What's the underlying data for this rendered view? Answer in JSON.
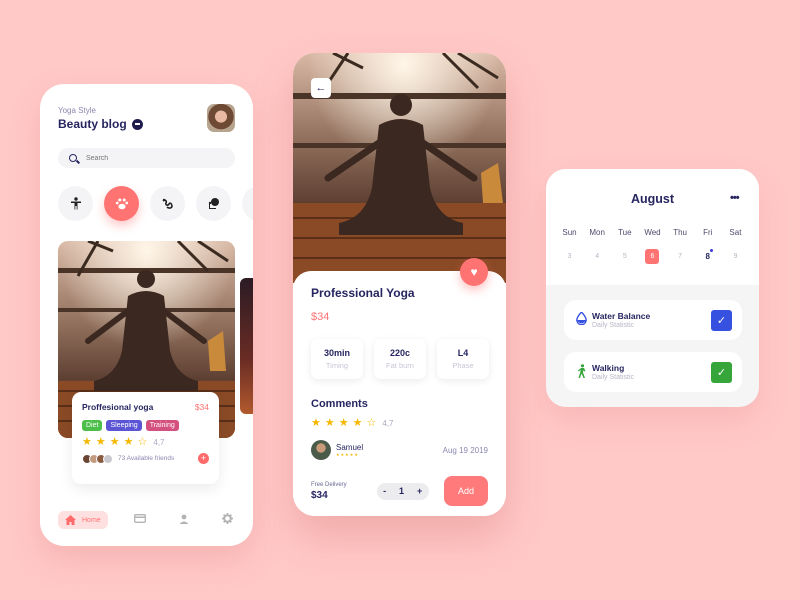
{
  "colors": {
    "background": "#ffc9c7",
    "accent": "#ff7373",
    "navy": "#262560",
    "star": "#f5b800",
    "tag_diet": "#4cbe4a",
    "tag_sleeping": "#5b55d6",
    "tag_training": "#d4507e",
    "water_check": "#3650e0",
    "walking_check": "#36a53a"
  },
  "blog": {
    "subtitle": "Yoga Style",
    "title": "Beauty blog",
    "search_placeholder": "Search",
    "categories": [
      {
        "name": "stretch",
        "icon": "☨"
      },
      {
        "name": "paw",
        "icon": "❀"
      },
      {
        "name": "pose",
        "icon": "§"
      },
      {
        "name": "meditate",
        "icon": "♣"
      }
    ],
    "card": {
      "title": "Proffesional yoga",
      "price": "$34",
      "tags": [
        "Diet",
        "Sleeping",
        "Training"
      ],
      "rating": "4,7",
      "friends_text": "73 Available friends"
    },
    "nav": {
      "home_label": "Home"
    }
  },
  "detail": {
    "title": "Professional Yoga",
    "price": "$34",
    "stats": [
      {
        "value": "30min",
        "label": "Timing"
      },
      {
        "value": "220c",
        "label": "Fat burn"
      },
      {
        "value": "L4",
        "label": "Phase"
      }
    ],
    "comments_title": "Comments",
    "rating": "4,7",
    "comment": {
      "name": "Samuel",
      "date": "Aug 19 2019"
    },
    "delivery_label": "Free Delivery",
    "delivery_price": "$34",
    "qty_minus": "-",
    "qty_value": "1",
    "qty_plus": "+",
    "add_label": "Add"
  },
  "calendar": {
    "month": "August",
    "weekdays": [
      "Sun",
      "Mon",
      "Tue",
      "Wed",
      "Thu",
      "Fri",
      "Sat"
    ],
    "days": [
      "3",
      "4",
      "5",
      "6",
      "7",
      "8",
      "9"
    ],
    "selected_day": "6",
    "marked_day": "8",
    "tasks": [
      {
        "name": "Water Balance",
        "subtitle": "Daily Statistic",
        "checked": true
      },
      {
        "name": "Walking",
        "subtitle": "Daily Statistic",
        "checked": true
      }
    ]
  }
}
